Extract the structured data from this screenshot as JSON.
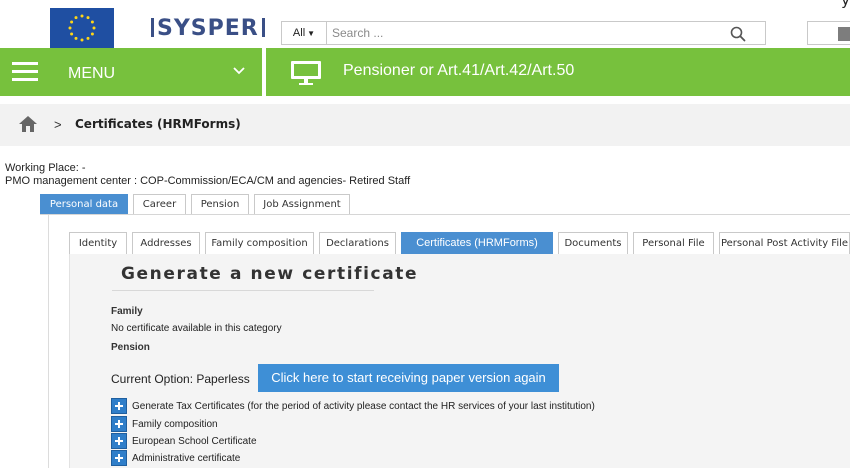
{
  "header": {
    "cut_text": "y",
    "logo_text": "SYSPER",
    "search": {
      "scope": "All",
      "placeholder": "Search ..."
    }
  },
  "menubar": {
    "menu_label": "MENU",
    "status_label": "Pensioner or Art.41/Art.42/Art.50"
  },
  "breadcrumb": {
    "separator": ">",
    "current": "Certificates (HRMForms)"
  },
  "working_place": {
    "line1": "Working Place: -",
    "line2": "PMO management center : COP-Commission/ECA/CM and agencies- Retired Staff"
  },
  "main_tabs": [
    {
      "label": "Personal data",
      "active": true
    },
    {
      "label": "Career",
      "active": false
    },
    {
      "label": "Pension",
      "active": false
    },
    {
      "label": "Job Assignment",
      "active": false
    }
  ],
  "sub_tabs": [
    {
      "label": "Identity",
      "active": false
    },
    {
      "label": "Addresses",
      "active": false
    },
    {
      "label": "Family composition",
      "active": false
    },
    {
      "label": "Declarations",
      "active": false
    },
    {
      "label": "Certificates (HRMForms)",
      "active": true
    },
    {
      "label": "Documents",
      "active": false
    },
    {
      "label": "Personal File",
      "active": false
    },
    {
      "label": "Personal Post Activity File",
      "active": false
    }
  ],
  "content": {
    "title": "Generate a new certificate",
    "family_heading": "Family",
    "family_empty": "No certificate available in this category",
    "pension_heading": "Pension",
    "current_option": "Current Option: Paperless",
    "paper_button": "Click here to start receiving paper version again",
    "certificates": [
      "Generate Tax Certificates (for the period of activity please contact the HR services of your last institution)",
      "Family composition",
      "European School Certificate",
      "Administrative certificate"
    ]
  },
  "colors": {
    "menubar": "#77c13d",
    "active_tab": "#4a8fd1",
    "button": "#3e8fd6",
    "logo": "#3a4f86"
  }
}
